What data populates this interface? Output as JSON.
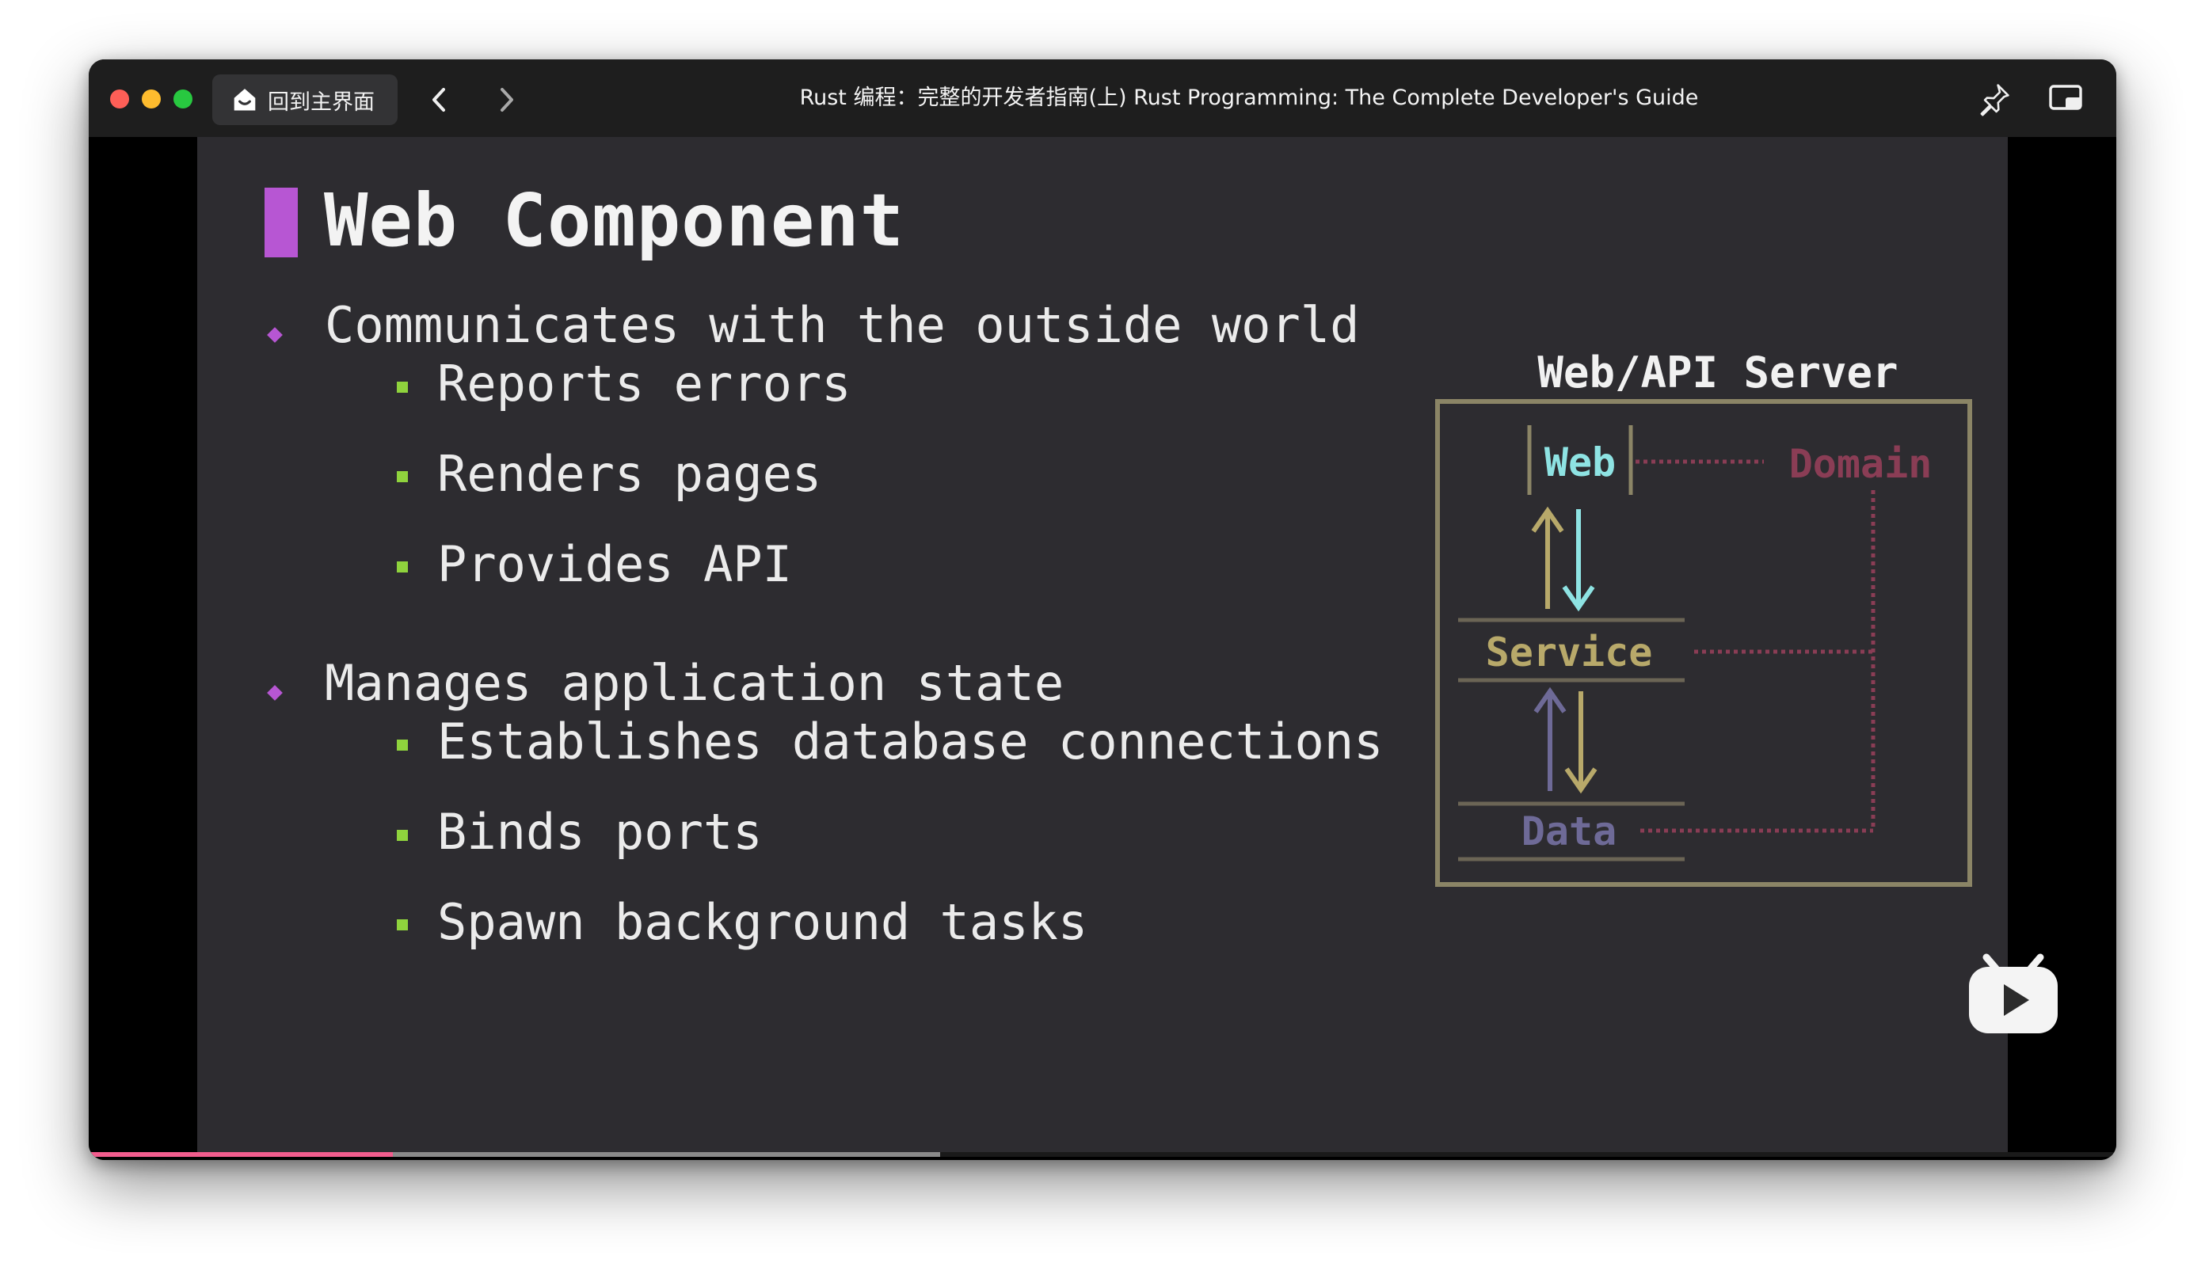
{
  "window": {
    "title": "Rust 编程：完整的开发者指南(上) Rust Programming: The Complete Developer's Guide",
    "home_button_label": "回到主界面",
    "traffic_lights": [
      "close",
      "minimize",
      "zoom"
    ],
    "icons": {
      "home": "home-icon",
      "back": "chevron-left-icon",
      "forward": "chevron-right-icon",
      "pin": "pin-icon",
      "pip": "picture-in-picture-icon",
      "player_logo": "bilibili-tv-icon"
    }
  },
  "slide": {
    "title": "Web Component",
    "accent_color": "#b756d3",
    "sub_bullet_color": "#8fd33d",
    "bullets": [
      {
        "text": "Communicates with the outside world",
        "children": [
          "Reports errors",
          "Renders pages",
          "Provides API"
        ]
      },
      {
        "text": "Manages application state",
        "children": [
          "Establishes database connections",
          "Binds ports",
          "Spawn background tasks"
        ]
      }
    ],
    "diagram": {
      "title": "Web/API Server",
      "layers": [
        "Web",
        "Service",
        "Data"
      ],
      "side_label": "Domain",
      "colors": {
        "frame": "#8b8566",
        "web": "#8ee3e3",
        "service": "#b8a96a",
        "data": "#6e6a97",
        "domain": "#8a3d55"
      }
    }
  },
  "player": {
    "progress_fraction": 0.15,
    "buffered_fraction": 0.42
  }
}
